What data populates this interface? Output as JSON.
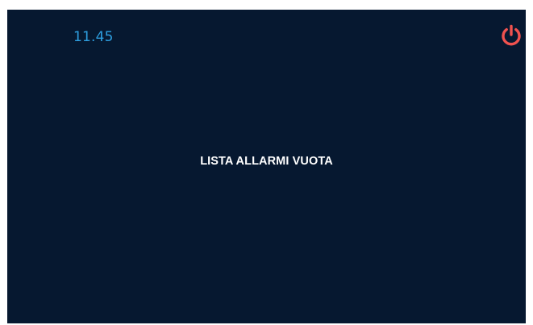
{
  "header": {
    "time": "11.45",
    "power_icon": "power-icon"
  },
  "main": {
    "empty_message": "LISTA ALLARMI VUOTA"
  },
  "colors": {
    "background": "#061830",
    "time": "#2e9fe0",
    "power": "#f0524f",
    "message": "#ffffff"
  }
}
